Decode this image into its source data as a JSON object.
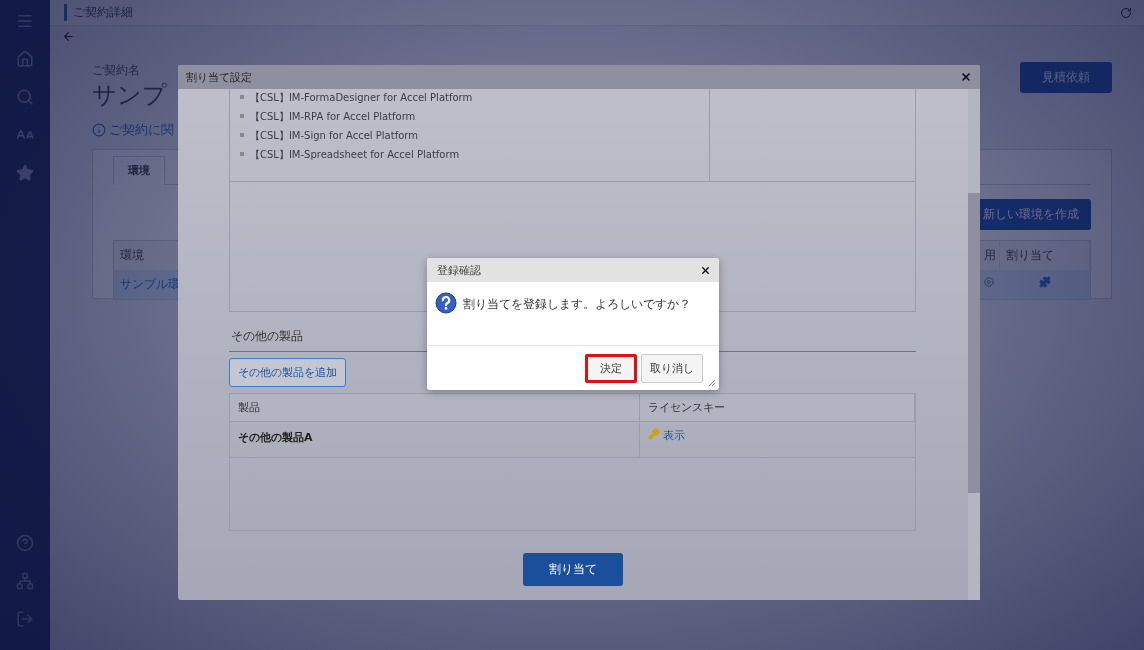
{
  "page": {
    "title": "ご契約詳細",
    "contract_label": "ご契約名",
    "contract_name": "サンプ",
    "info_link": "ご契約に関",
    "quote_button": "見積依頼",
    "tabs": [
      {
        "label": "環境",
        "selected": true
      }
    ],
    "create_button": "新しい環境を作成",
    "table": {
      "columns": [
        "環境",
        "用",
        "割り当て"
      ],
      "rows": [
        {
          "environment": "サンプル環",
          "selected": true
        }
      ]
    }
  },
  "modal": {
    "title": "割り当て設定",
    "products": [
      "【CSL】IM-FormaDesigner for Accel Platform",
      "【CSL】IM-RPA for Accel Platform",
      "【CSL】IM-Sign for Accel Platform",
      "【CSL】IM-Spreadsheet for Accel Platform"
    ],
    "other_heading": "その他の製品",
    "add_button": "その他の製品を追加",
    "other_table": {
      "columns": [
        "製品",
        "ライセンスキー"
      ],
      "rows": [
        {
          "product": "その他の製品A",
          "license_link": "表示"
        }
      ]
    },
    "assign_button": "割り当て"
  },
  "confirm": {
    "title": "登録確認",
    "message": "割り当てを登録します。よろしいですか？",
    "buttons": [
      {
        "label": "決定",
        "highlighted": true
      },
      {
        "label": "取り消し",
        "highlighted": false
      }
    ]
  }
}
